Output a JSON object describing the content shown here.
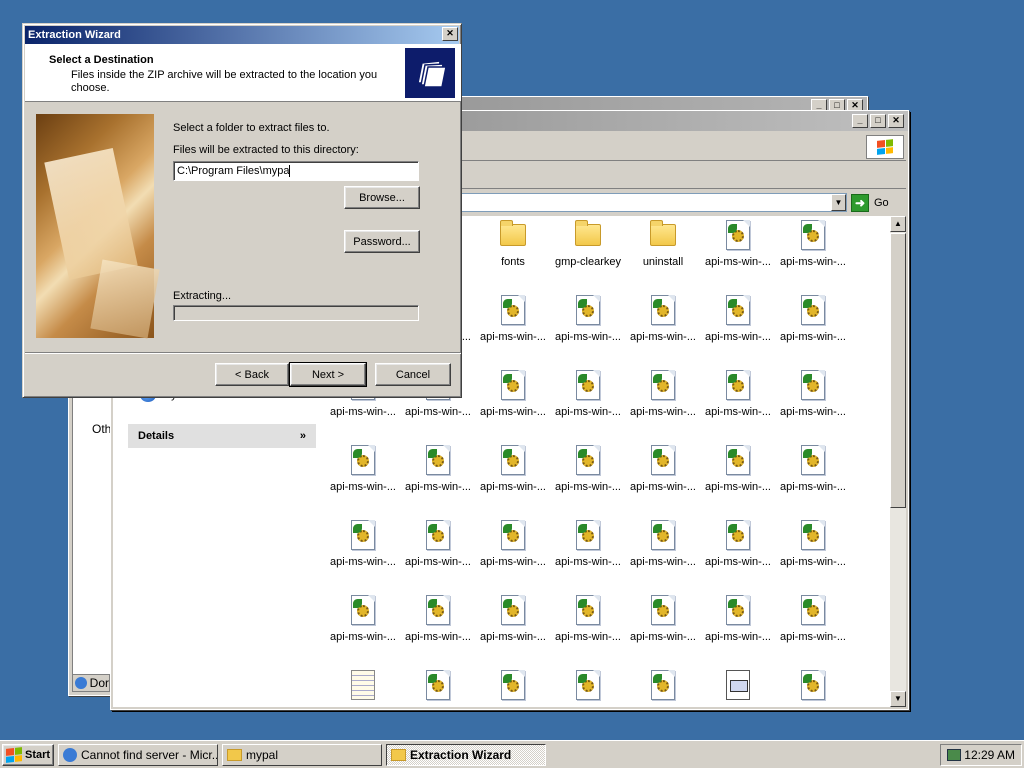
{
  "wizard": {
    "title": "Extraction Wizard",
    "close_glyph": "✕",
    "header_title": "Select a Destination",
    "header_subtitle": "Files inside the ZIP archive will be extracted to the location you choose.",
    "label_select_folder": "Select a folder to extract files to.",
    "label_directory": "Files will be extracted to this directory:",
    "path_value": "C:\\Program Files\\mypa",
    "browse_label": "Browse...",
    "password_label": "Password...",
    "extracting_label": "Extracting...",
    "progress": 0,
    "back_label": "< Back",
    "next_label": "Next >",
    "cancel_label": "Cancel"
  },
  "explorer": {
    "go_label": "Go",
    "left_pane": {
      "network_places": "My Network Places",
      "details_label": "Details"
    },
    "files": [
      {
        "name": "fonts",
        "type": "folder"
      },
      {
        "name": "gmp-clearkey",
        "type": "folder"
      },
      {
        "name": "uninstall",
        "type": "folder"
      },
      {
        "name": "api-ms-win-...",
        "type": "dll"
      },
      {
        "name": "api-ms-win-...",
        "type": "dll"
      }
    ],
    "grid_label": "api-ms-win-..."
  },
  "desktop": {
    "partial_text": "Oth",
    "partial_tab": "Dor"
  },
  "taskbar": {
    "start_label": "Start",
    "items": [
      {
        "label": "Cannot find server - Micr..."
      },
      {
        "label": "mypal"
      },
      {
        "label": "Extraction Wizard"
      }
    ],
    "clock": "12:29 AM"
  }
}
